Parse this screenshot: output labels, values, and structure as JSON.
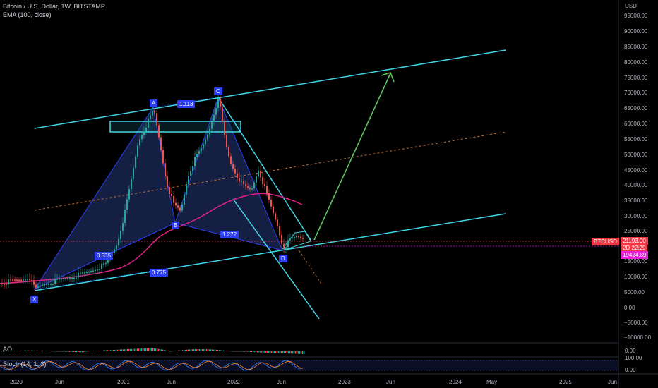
{
  "legend": {
    "title": "Bitcoin / U.S. Dollar, 1W, BITSTAMP",
    "ema": "EMA (100, close)"
  },
  "price_axis": {
    "currency": "USD",
    "labels": [
      "95000.00",
      "90000.00",
      "85000.00",
      "80000.00",
      "75000.00",
      "70000.00",
      "65000.00",
      "60000.00",
      "55000.00",
      "50000.00",
      "45000.00",
      "40000.00",
      "35000.00",
      "30000.00",
      "25000.00",
      "15000.00",
      "10000.00",
      "5000.00",
      "0.00",
      "−5000.00",
      "−10000.00"
    ]
  },
  "price_tags": {
    "symbol": "BTCUSD",
    "last_price": "21193.00",
    "countdown": "2D 22:29",
    "ema_value": "19424.89"
  },
  "time_axis": {
    "labels": [
      "2020",
      "Jun",
      "2021",
      "Jun",
      "2022",
      "Jun",
      "2023",
      "Jun",
      "2024",
      "May",
      "2025",
      "Jun"
    ]
  },
  "pattern_points": {
    "x": "X",
    "a": "A",
    "b": "B",
    "c": "C",
    "d": "D"
  },
  "ratios": {
    "xab": "0.535",
    "abc": "1.113",
    "bcd": "1.272",
    "xad": "0.775"
  },
  "ao_pane": {
    "title": "AO",
    "value": "0.00"
  },
  "stoch_pane": {
    "title": "Stoch (14, 1, 3)",
    "top": "100.00",
    "bottom": "0.00"
  },
  "colors": {
    "background": "#000000",
    "channel": "#3fd8e8",
    "pattern_fill": "#1c2a5a",
    "pattern_stroke": "#2b3ef5",
    "ema": "#e0218a",
    "projection_arrow": "#5fc35f",
    "midline": "#c0703a",
    "bull_candle": "#26a69a",
    "bear_candle": "#ef5350",
    "price_tag": "#f23645",
    "ema_tag": "#e91ed9"
  }
}
